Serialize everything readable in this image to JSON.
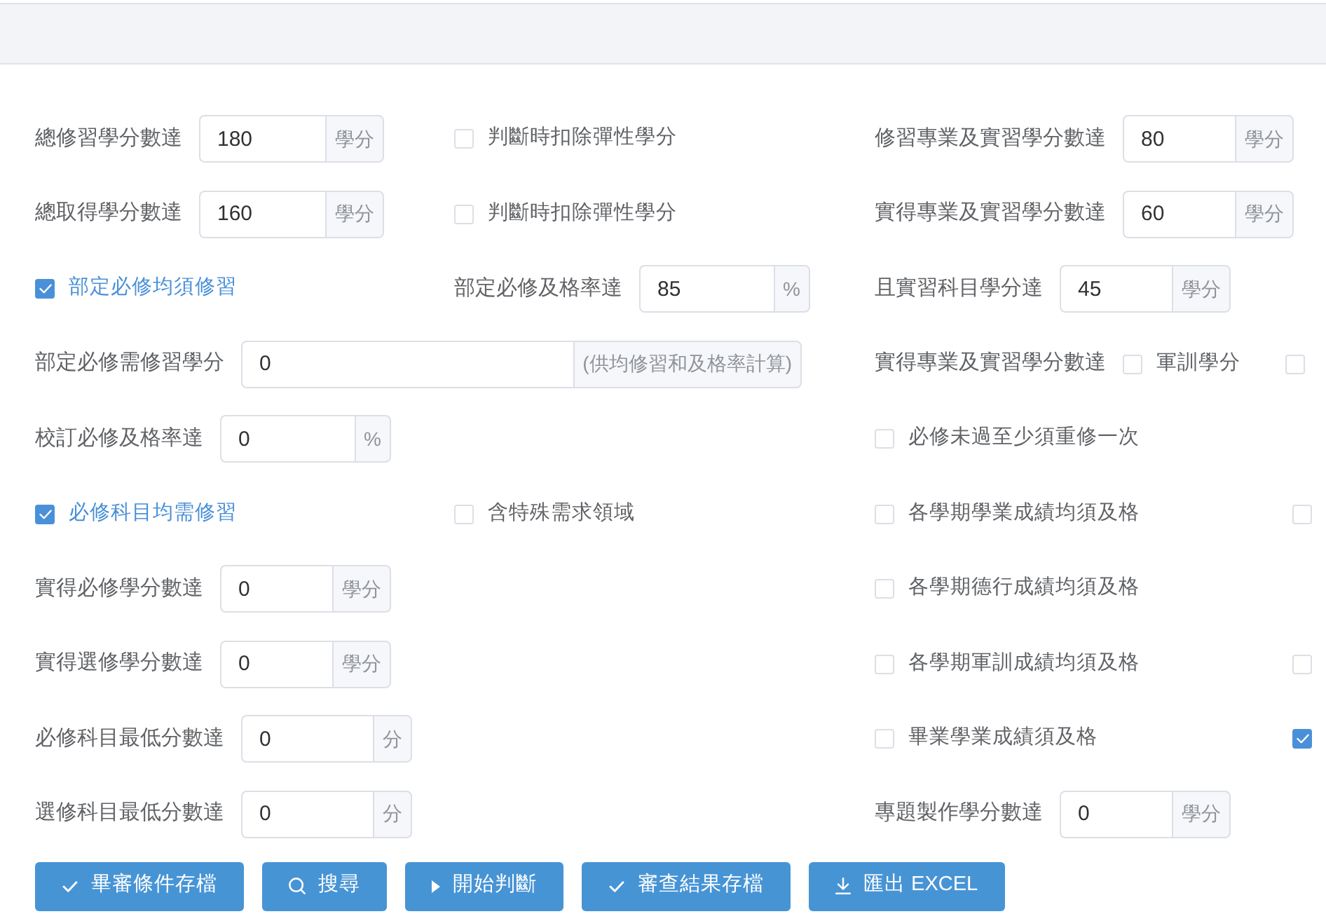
{
  "rows": [
    {
      "left": {
        "kind": "field",
        "label": "總修習學分數達",
        "value": "180",
        "unit": "學分"
      },
      "middle": {
        "kind": "checkbox",
        "label": "判斷時扣除彈性學分",
        "checked": false
      },
      "right": {
        "kind": "field",
        "label": "修習專業及實習學分數達",
        "value": "80",
        "unit": "學分"
      }
    },
    {
      "left": {
        "kind": "field",
        "label": "總取得學分數達",
        "value": "160",
        "unit": "學分"
      },
      "middle": {
        "kind": "checkbox",
        "label": "判斷時扣除彈性學分",
        "checked": false
      },
      "right": {
        "kind": "field",
        "label": "實得專業及實習學分數達",
        "value": "60",
        "unit": "學分"
      }
    },
    {
      "left": {
        "kind": "checkbox",
        "label": "部定必修均須修習",
        "checked": true
      },
      "middle": {
        "kind": "field",
        "label": "部定必修及格率達",
        "value": "85",
        "unit": "%"
      },
      "right": {
        "kind": "field",
        "label": "且實習科目學分達",
        "value": "45",
        "unit": "學分"
      }
    },
    {
      "left": {
        "kind": "wide_field",
        "label": "部定必修需修習學分",
        "value": "0",
        "unit": "(供均修習和及格率計算)"
      },
      "right": {
        "kind": "checkbox_group",
        "label": "實得專業及實習學分數達",
        "options": [
          {
            "label": "軍訓學分",
            "checked": false
          },
          {
            "checked": false
          }
        ]
      }
    },
    {
      "left": {
        "kind": "field",
        "label": "校訂必修及格率達",
        "value": "0",
        "unit": "%"
      },
      "right": {
        "kind": "checkbox",
        "label": "必修未過至少須重修一次",
        "checked": false
      }
    },
    {
      "left": {
        "kind": "checkbox",
        "label": "必修科目均需修習",
        "checked": true
      },
      "middle": {
        "kind": "checkbox",
        "label": "含特殊需求領域",
        "checked": false
      },
      "right": {
        "kind": "checkbox",
        "label": "各學期學業成績均須及格",
        "checked": false
      },
      "edge": {
        "kind": "checkbox",
        "checked": false
      }
    },
    {
      "left": {
        "kind": "field",
        "label": "實得必修學分數達",
        "value": "0",
        "unit": "學分"
      },
      "right": {
        "kind": "checkbox",
        "label": "各學期德行成績均須及格",
        "checked": false
      }
    },
    {
      "left": {
        "kind": "field",
        "label": "實得選修學分數達",
        "value": "0",
        "unit": "學分"
      },
      "right": {
        "kind": "checkbox",
        "label": "各學期軍訓成績均須及格",
        "checked": false
      },
      "edge": {
        "kind": "checkbox",
        "checked": false
      }
    },
    {
      "left": {
        "kind": "field",
        "label": "必修科目最低分數達",
        "value": "0",
        "unit": "分"
      },
      "right": {
        "kind": "checkbox",
        "label": "畢業學業成績須及格",
        "checked": false
      },
      "edge": {
        "kind": "checkbox",
        "checked": true
      }
    },
    {
      "left": {
        "kind": "field",
        "label": "選修科目最低分數達",
        "value": "0",
        "unit": "分"
      },
      "right": {
        "kind": "field",
        "label": "專題製作學分數達",
        "value": "0",
        "unit": "學分"
      }
    }
  ],
  "buttons": [
    {
      "kind": "save",
      "label": "畢審條件存檔"
    },
    {
      "kind": "search",
      "label": "搜尋"
    },
    {
      "kind": "run",
      "label": "開始判斷"
    },
    {
      "kind": "save",
      "label": "審查結果存檔"
    },
    {
      "kind": "export",
      "label": "匯出 EXCEL"
    }
  ]
}
